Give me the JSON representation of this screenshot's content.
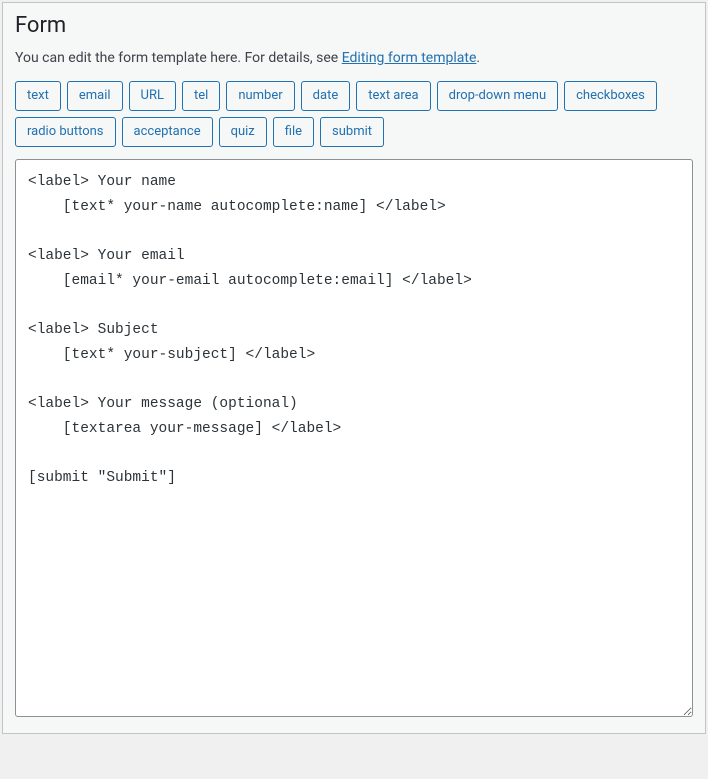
{
  "panel": {
    "title": "Form",
    "description_prefix": "You can edit the form template here. For details, see ",
    "description_link": "Editing form template",
    "description_suffix": "."
  },
  "tag_buttons": [
    "text",
    "email",
    "URL",
    "tel",
    "number",
    "date",
    "text area",
    "drop-down menu",
    "checkboxes",
    "radio buttons",
    "acceptance",
    "quiz",
    "file",
    "submit"
  ],
  "form_template": "<label> Your name\n    [text* your-name autocomplete:name] </label>\n\n<label> Your email\n    [email* your-email autocomplete:email] </label>\n\n<label> Subject\n    [text* your-subject] </label>\n\n<label> Your message (optional)\n    [textarea your-message] </label>\n\n[submit \"Submit\"]"
}
